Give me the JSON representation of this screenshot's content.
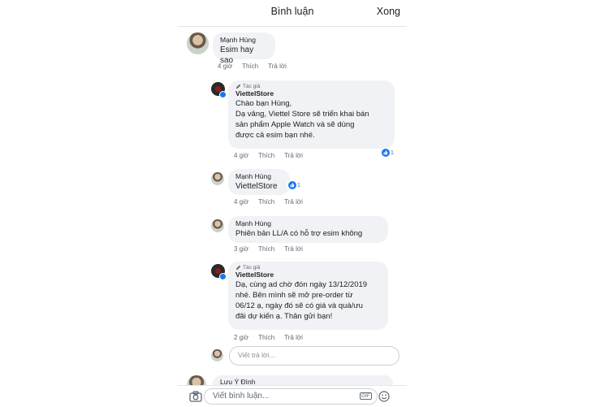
{
  "header": {
    "title": "Bình luận",
    "done_label": "Xong"
  },
  "comments": [
    {
      "name": "Mạnh Hùng",
      "text": "Esim hay sao",
      "time": "4 giờ",
      "like": "Thích",
      "reply": "Trả lời"
    },
    {
      "tag": "Tác giả",
      "name": "ViettelStore",
      "lines": [
        "Chào bạn Hùng,",
        "Dạ vâng, Viettel Store sẽ triển khai bán",
        "sản phẩm Apple Watch và sẽ dùng",
        "được cả esim bạn nhé."
      ],
      "time": "4 giờ",
      "like": "Thích",
      "reply": "Trả lời",
      "reactions": "1"
    },
    {
      "name": "Mạnh Hùng",
      "mention": "ViettelStore",
      "time": "4 giờ",
      "like": "Thích",
      "reply": "Trả lời",
      "reactions": "1"
    },
    {
      "name": "Mạnh Hùng",
      "text": "Phiên bản LL/A  có hỗ trợ esim không",
      "time": "3 giờ",
      "like": "Thích",
      "reply": "Trả lời"
    },
    {
      "tag": "Tác giả",
      "name": "ViettelStore",
      "lines": [
        "Dạ, cùng ad chờ đón ngày 13/12/2019",
        "nhé. Bên mình sẽ mở pre-order từ",
        "06/12 ạ, ngày đó sẽ có giá và quà/ưu",
        "đãi dự kiến ạ. Thân gửi bạn!"
      ],
      "time": "2 giờ",
      "like": "Thích",
      "reply": "Trả lời"
    }
  ],
  "reply_box": {
    "placeholder": "Viết trả lời..."
  },
  "partial_comment": {
    "name": "Lưu Ý Đình"
  },
  "footer": {
    "placeholder": "Viết bình luận...",
    "gif_label": "GIF"
  },
  "colors": {
    "accent": "#1877f2",
    "bubble": "#f0f2f5",
    "meta": "#65676b"
  },
  "icons": [
    "camera-icon",
    "gif-icon",
    "emoji-icon",
    "pencil-icon",
    "verified-badge-icon",
    "like-reaction-icon"
  ]
}
